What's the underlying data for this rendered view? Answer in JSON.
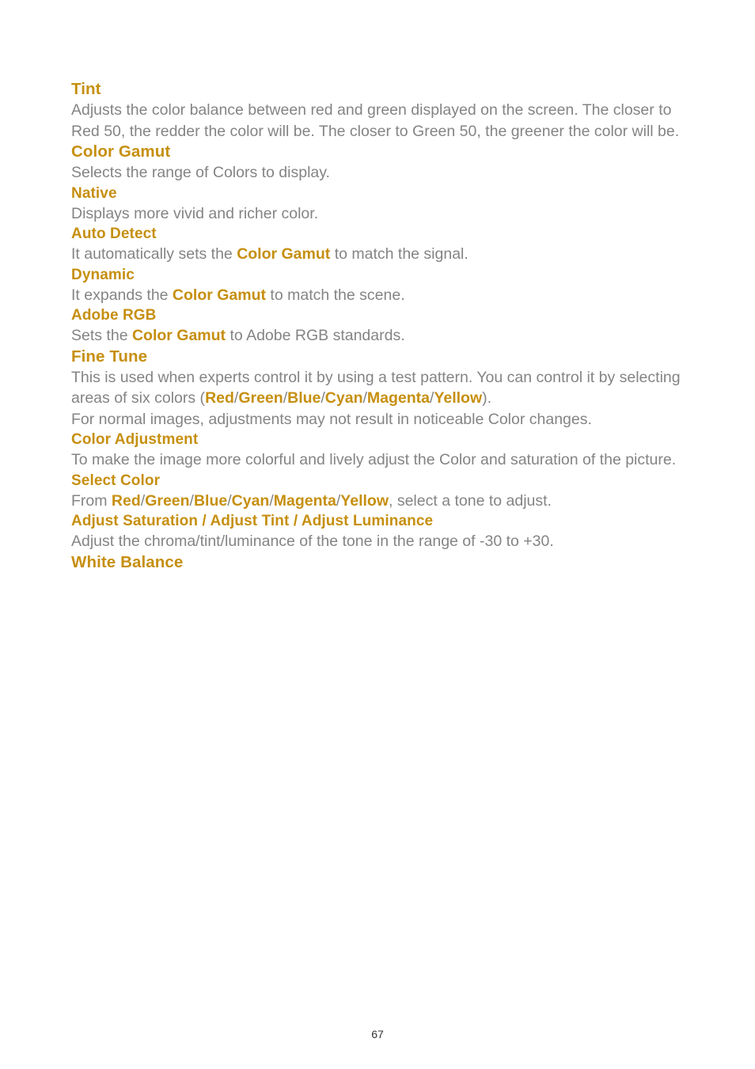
{
  "page": {
    "number": "67",
    "colors": {
      "heading_gold": "#c68f10",
      "body_gray": "#848484",
      "background": "#ffffff",
      "page_number": "#333333"
    }
  },
  "sections": [
    {
      "id": "tint",
      "level": "top",
      "heading": "Tint",
      "body": "Adjusts the color balance between red and green displayed on the screen. The closer to Red 50, the redder the color will be. The closer to Green 50, the greener the color will be."
    },
    {
      "id": "color-gamut",
      "level": "top",
      "heading": "Color Gamut",
      "body": "Selects the range of Colors to display."
    },
    {
      "id": "native",
      "level": "sub",
      "heading": "Native",
      "body": "Displays more vivid and richer color."
    },
    {
      "id": "auto-detect",
      "level": "sub",
      "heading": "Auto Detect",
      "body_parts": {
        "before": "It automatically sets the ",
        "term": "Color Gamut",
        "after": " to match the signal."
      }
    },
    {
      "id": "dynamic",
      "level": "sub",
      "heading": "Dynamic",
      "body_parts": {
        "before": "It expands the ",
        "term": "Color Gamut",
        "after": " to match the scene."
      }
    },
    {
      "id": "adobe-rgb",
      "level": "sub",
      "heading": "Adobe RGB",
      "body_parts": {
        "before": "Sets the ",
        "term": "Color Gamut",
        "after": " to Adobe RGB standards."
      }
    },
    {
      "id": "fine-tune",
      "level": "top",
      "heading": "Fine Tune",
      "body_parts": {
        "line1": "This is used when experts control it by using a test pattern. You can control it by selecting areas of six colors (",
        "colors": [
          "Red",
          "Green",
          "Blue",
          "Cyan",
          "Magenta",
          "Yellow"
        ],
        "separator": "/",
        "line1_end": ").",
        "line2": "For normal images, adjustments may not result in noticeable Color changes."
      }
    },
    {
      "id": "color-adjustment",
      "level": "sub",
      "heading": "Color Adjustment",
      "body": "To make the image more colorful and lively adjust the Color and saturation of the picture."
    },
    {
      "id": "select-color",
      "level": "sub",
      "heading": "Select Color",
      "body_parts": {
        "before": "From ",
        "colors": [
          "Red",
          "Green",
          "Blue",
          "Cyan",
          "Magenta",
          "Yellow"
        ],
        "separator": "/",
        "after": ", select a tone to adjust."
      }
    },
    {
      "id": "adjust-group",
      "level": "sub",
      "heading_parts": {
        "items": [
          "Adjust Saturation",
          "Adjust Tint",
          "Adjust Luminance"
        ],
        "separator": " / "
      },
      "body": "Adjust the chroma/tint/luminance of the tone in the range of -30 to +30."
    },
    {
      "id": "white-balance",
      "level": "top",
      "heading": "White Balance",
      "body": ""
    }
  ],
  "headings": {
    "tint": "Tint",
    "color_gamut": "Color Gamut",
    "native": "Native",
    "auto_detect": "Auto Detect",
    "dynamic": "Dynamic",
    "adobe_rgb": "Adobe RGB",
    "fine_tune": "Fine Tune",
    "color_adjustment": "Color Adjustment",
    "select_color": "Select Color",
    "adjust_saturation": "Adjust Saturation",
    "adjust_tint": "Adjust Tint",
    "adjust_luminance": "Adjust Luminance",
    "white_balance": "White Balance"
  },
  "bodies": {
    "tint": "Adjusts the color balance between red and green displayed on the screen. The closer to Red 50, the redder the color will be. The closer to Green 50, the greener the color will be.",
    "color_gamut": "Selects the range of Colors to display.",
    "native": "Displays more vivid and richer color.",
    "auto_detect_before": "It automatically sets the ",
    "auto_detect_term": "Color Gamut",
    "auto_detect_after": " to match the signal.",
    "dynamic_before": "It expands the ",
    "dynamic_term": "Color Gamut",
    "dynamic_after": " to match the scene.",
    "adobe_rgb_before": "Sets the ",
    "adobe_rgb_term": "Color Gamut",
    "adobe_rgb_after": " to Adobe RGB standards.",
    "fine_tune_lead": "This is used when experts control it by using a test pattern. You can control it by selecting areas of six colors (",
    "fine_tune_close": ").",
    "fine_tune_line2": "For normal images, adjustments may not result in noticeable Color changes.",
    "color_adjustment": "To make the image more colorful and lively adjust the Color and saturation of the picture.",
    "select_color_before": "From ",
    "select_color_after": ", select a tone to adjust.",
    "adjust_group": "Adjust the chroma/tint/luminance of the tone in the range of -30 to +30."
  },
  "color_names": {
    "red": "Red",
    "green": "Green",
    "blue": "Blue",
    "cyan": "Cyan",
    "magenta": "Magenta",
    "yellow": "Yellow",
    "slash": "/",
    "slash_spaced": " / "
  },
  "footer": {
    "page_number": "67"
  }
}
